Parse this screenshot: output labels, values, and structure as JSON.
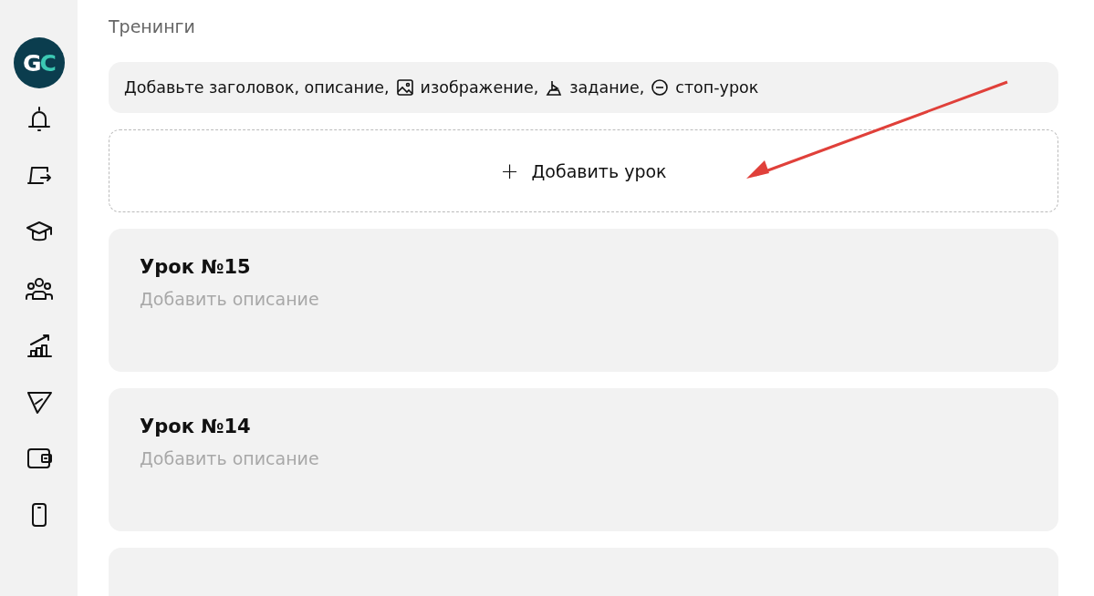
{
  "sidebar": {
    "logo": {
      "first": "G",
      "second": "C"
    },
    "items": [
      {
        "kind": "bell"
      },
      {
        "kind": "exit"
      },
      {
        "kind": "cap"
      },
      {
        "kind": "people"
      },
      {
        "kind": "chart"
      },
      {
        "kind": "send"
      },
      {
        "kind": "wallet"
      },
      {
        "kind": "phone"
      }
    ]
  },
  "page_title": "Тренинги",
  "hint": [
    {
      "kind": "text",
      "text": "Добавьте заголовок, описание,"
    },
    {
      "kind": "image",
      "text": "изображение,"
    },
    {
      "kind": "task",
      "text": "задание,"
    },
    {
      "kind": "stop",
      "text": "стоп-урок"
    }
  ],
  "add_button": {
    "icon": "+",
    "label": "Добавить урок"
  },
  "lessons": [
    {
      "kind": "lesson",
      "title": "Урок №15",
      "placeholder": "Добавить описание"
    },
    {
      "kind": "lesson",
      "title": "Урок №14",
      "placeholder": "Добавить описание"
    },
    {
      "kind": "cut_off"
    }
  ]
}
